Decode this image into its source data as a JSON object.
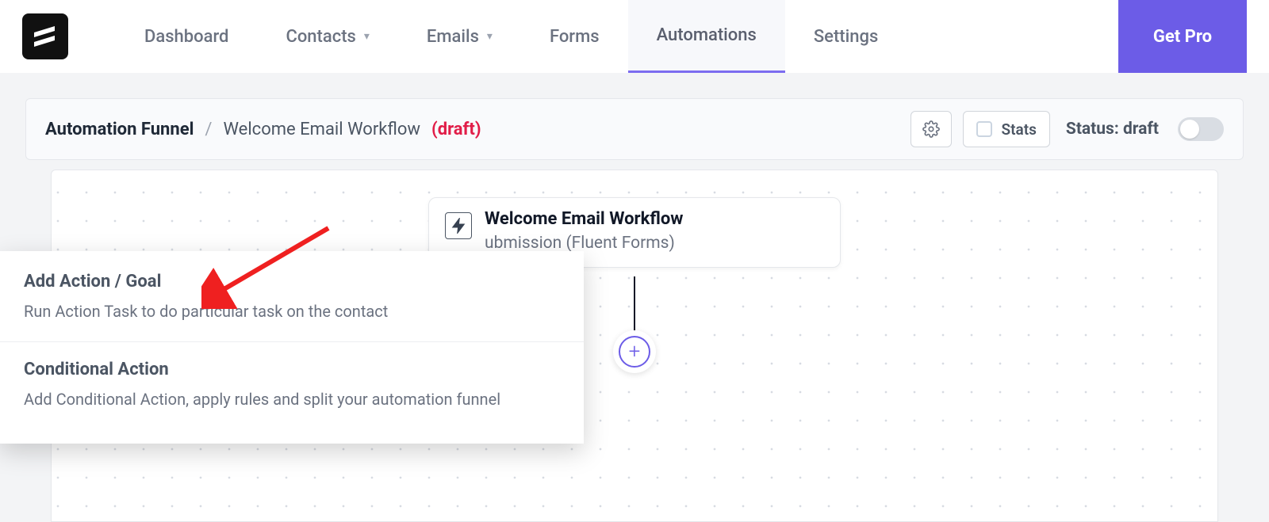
{
  "nav": {
    "dashboard": "Dashboard",
    "contacts": "Contacts",
    "emails": "Emails",
    "forms": "Forms",
    "automations": "Automations",
    "settings": "Settings",
    "get_pro": "Get Pro"
  },
  "header": {
    "title": "Automation Funnel",
    "separator": "/",
    "workflow_name": "Welcome Email Workflow",
    "draft_tag": "(draft)",
    "stats_label": "Stats",
    "status_label": "Status: draft"
  },
  "node": {
    "title": "Welcome Email Workflow",
    "subtitle": "ubmission (Fluent Forms)"
  },
  "popup": {
    "items": [
      {
        "title": "Add Action / Goal",
        "desc": "Run Action Task to do particular task on the contact"
      },
      {
        "title": "Conditional Action",
        "desc": "Add Conditional Action, apply rules and split your automation funnel"
      }
    ]
  }
}
